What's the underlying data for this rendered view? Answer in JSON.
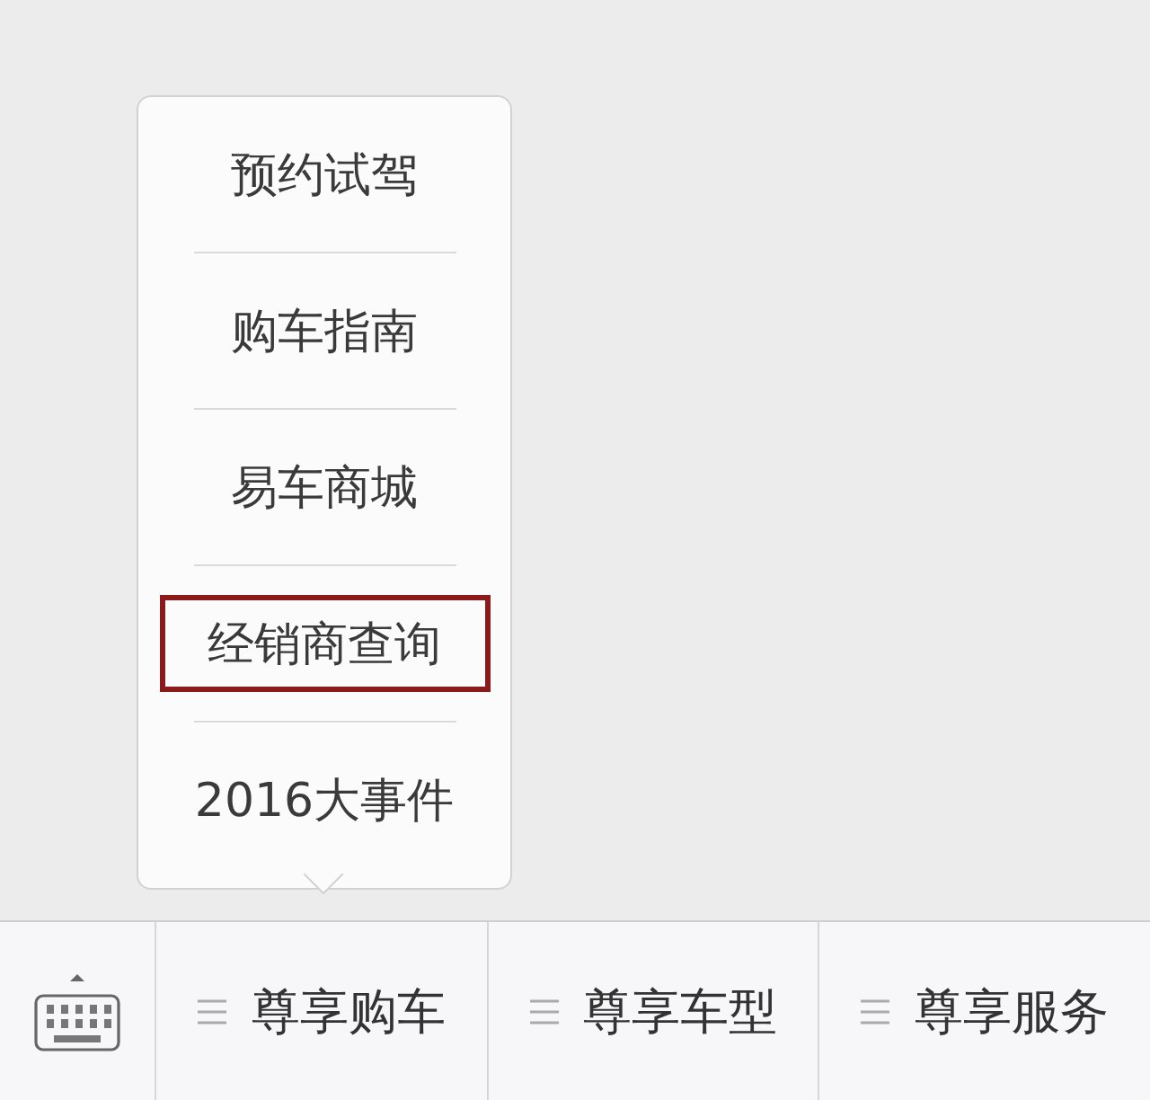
{
  "popup_menu": {
    "items": [
      {
        "label": "预约试驾",
        "selected": false
      },
      {
        "label": "购车指南",
        "selected": false
      },
      {
        "label": "易车商城",
        "selected": false
      },
      {
        "label": "经销商查询",
        "selected": true
      },
      {
        "label": "2016大事件",
        "selected": false
      }
    ]
  },
  "menu_bar": {
    "tabs": [
      {
        "label": "尊享购车"
      },
      {
        "label": "尊享车型"
      },
      {
        "label": "尊享服务"
      }
    ]
  }
}
